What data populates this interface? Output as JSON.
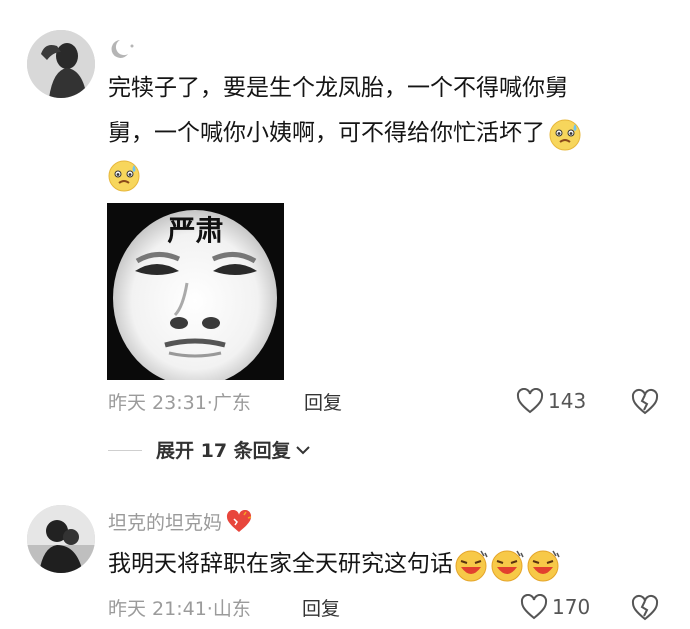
{
  "comments": [
    {
      "username": "",
      "lines": [
        "完犊子了，要是生个龙凤胎，一个不得喊你舅",
        "舅，一个喊你小姨啊，可不得给你忙活坏了"
      ],
      "meme_caption": "严肃",
      "time": "昨天 23:31",
      "location": "广东",
      "reply_label": "回复",
      "likes": "143",
      "avatar_icon": "moon-icon"
    },
    {
      "username": "坦克的坦克妈",
      "text": "我明天将辞职在家全天研究这句话",
      "time": "昨天 21:41",
      "location": "山东",
      "reply_label": "回复",
      "likes": "170"
    }
  ],
  "thread": {
    "expand_label": "展开 17 条回复"
  },
  "colors": {
    "meta": "#9b9b9b",
    "text": "#151515",
    "heart_badge": "#e8463c"
  }
}
